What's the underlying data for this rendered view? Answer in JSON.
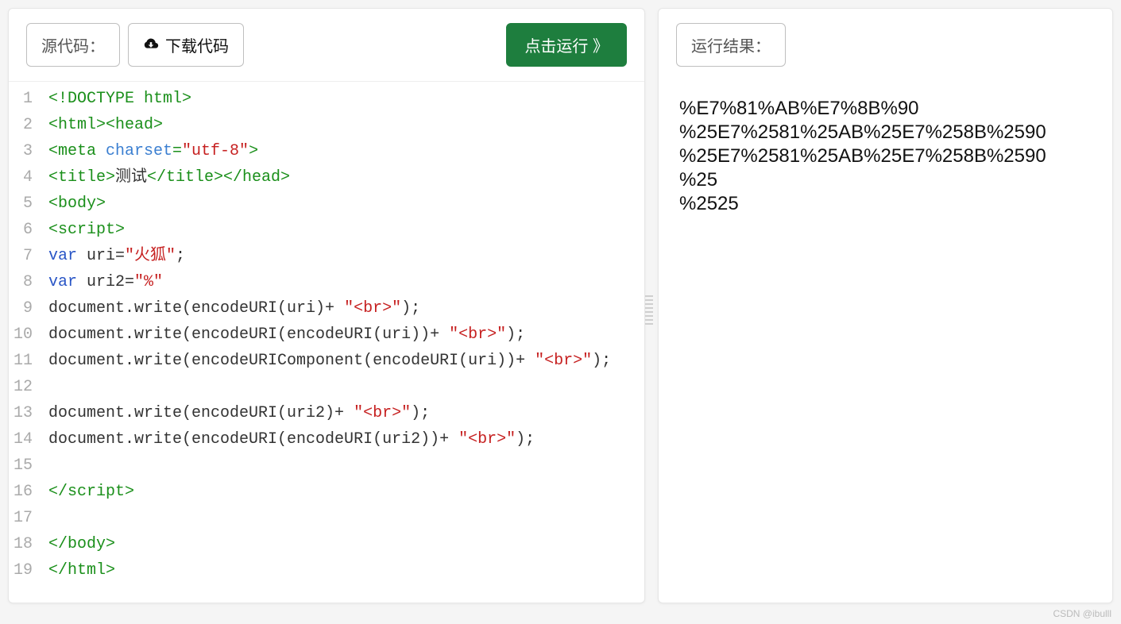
{
  "toolbar": {
    "source_label": "源代码：",
    "download_label": "下载代码",
    "run_label": "点击运行 》"
  },
  "result_label": "运行结果：",
  "code_lines": [
    {
      "n": 1,
      "tokens": [
        {
          "t": "<!DOCTYPE html>",
          "c": "tag"
        }
      ]
    },
    {
      "n": 2,
      "tokens": [
        {
          "t": "<html>",
          "c": "tag"
        },
        {
          "t": "<head>",
          "c": "tag"
        }
      ]
    },
    {
      "n": 3,
      "tokens": [
        {
          "t": "<meta ",
          "c": "tag"
        },
        {
          "t": "charset",
          "c": "attr"
        },
        {
          "t": "=",
          "c": "tag"
        },
        {
          "t": "\"utf-8\"",
          "c": "str"
        },
        {
          "t": ">",
          "c": "tag"
        }
      ]
    },
    {
      "n": 4,
      "tokens": [
        {
          "t": "<title>",
          "c": "tag"
        },
        {
          "t": "测试",
          "c": ""
        },
        {
          "t": "</title>",
          "c": "tag"
        },
        {
          "t": "</head>",
          "c": "tag"
        }
      ]
    },
    {
      "n": 5,
      "tokens": [
        {
          "t": "<body>",
          "c": "tag"
        }
      ]
    },
    {
      "n": 6,
      "tokens": [
        {
          "t": "<script>",
          "c": "tag"
        }
      ]
    },
    {
      "n": 7,
      "tokens": [
        {
          "t": "var",
          "c": "kw"
        },
        {
          "t": " uri=",
          "c": ""
        },
        {
          "t": "\"火狐\"",
          "c": "str"
        },
        {
          "t": ";",
          "c": ""
        }
      ]
    },
    {
      "n": 8,
      "tokens": [
        {
          "t": "var",
          "c": "kw"
        },
        {
          "t": " uri2=",
          "c": ""
        },
        {
          "t": "\"%\"",
          "c": "str"
        }
      ]
    },
    {
      "n": 9,
      "tokens": [
        {
          "t": "document.write(encodeURI(uri)+ ",
          "c": ""
        },
        {
          "t": "\"<br>\"",
          "c": "str"
        },
        {
          "t": ");",
          "c": ""
        }
      ]
    },
    {
      "n": 10,
      "tokens": [
        {
          "t": "document.write(encodeURI(encodeURI(uri))+ ",
          "c": ""
        },
        {
          "t": "\"<br>\"",
          "c": "str"
        },
        {
          "t": ");",
          "c": ""
        }
      ]
    },
    {
      "n": 11,
      "tokens": [
        {
          "t": "document.write(encodeURIComponent(encodeURI(uri))+ ",
          "c": ""
        },
        {
          "t": "\"<br>\"",
          "c": "str"
        },
        {
          "t": ");",
          "c": ""
        }
      ]
    },
    {
      "n": 12,
      "tokens": []
    },
    {
      "n": 13,
      "tokens": [
        {
          "t": "document.write(encodeURI(uri2)+ ",
          "c": ""
        },
        {
          "t": "\"<br>\"",
          "c": "str"
        },
        {
          "t": ");",
          "c": ""
        }
      ]
    },
    {
      "n": 14,
      "tokens": [
        {
          "t": "document.write(encodeURI(encodeURI(uri2))+ ",
          "c": ""
        },
        {
          "t": "\"<br>\"",
          "c": "str"
        },
        {
          "t": ");",
          "c": ""
        }
      ]
    },
    {
      "n": 15,
      "tokens": []
    },
    {
      "n": 16,
      "tokens": [
        {
          "t": "</script>",
          "c": "tag"
        }
      ]
    },
    {
      "n": 17,
      "tokens": []
    },
    {
      "n": 18,
      "tokens": [
        {
          "t": "</body>",
          "c": "tag"
        }
      ]
    },
    {
      "n": 19,
      "tokens": [
        {
          "t": "</html>",
          "c": "tag"
        }
      ]
    }
  ],
  "output_lines": [
    "%E7%81%AB%E7%8B%90",
    "%25E7%2581%25AB%25E7%258B%2590",
    "%25E7%2581%25AB%25E7%258B%2590",
    "%25",
    "%2525"
  ],
  "watermark": "CSDN @ibulll"
}
